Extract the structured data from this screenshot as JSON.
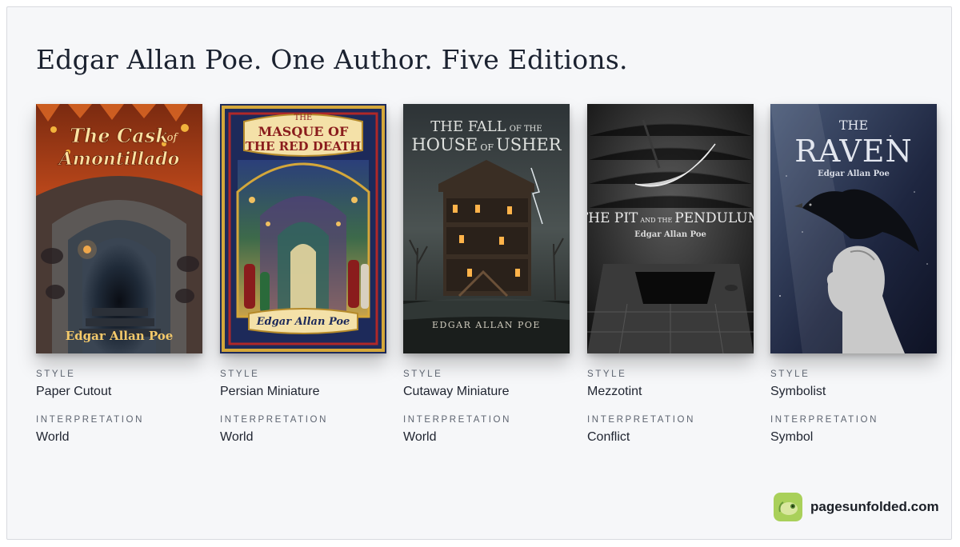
{
  "page": {
    "title": "Edgar Allan Poe. One Author. Five Editions."
  },
  "labels": {
    "style": "STYLE",
    "interpretation": "INTERPRETATION"
  },
  "books": [
    {
      "cover_title_1": "The Cask",
      "cover_title_of": "of",
      "cover_title_2": "Amontillado",
      "cover_author": "Edgar Allan Poe",
      "style": "Paper Cutout",
      "interpretation": "World"
    },
    {
      "cover_title_top": "THE",
      "cover_title_1": "MASQUE OF",
      "cover_title_2": "THE RED DEATH",
      "cover_author": "Edgar Allan Poe",
      "style": "Persian Miniature",
      "interpretation": "World"
    },
    {
      "cover_title_1a": "THE FALL",
      "cover_title_1b": "OF THE",
      "cover_title_2a": "HOUSE",
      "cover_title_2b": "OF",
      "cover_title_2c": "USHER",
      "cover_author": "EDGAR ALLAN POE",
      "style": "Cutaway Miniature",
      "interpretation": "World"
    },
    {
      "cover_title_a": "THE PIT",
      "cover_title_b": "AND THE",
      "cover_title_c": "PENDULUM",
      "cover_author": "Edgar Allan Poe",
      "style": "Mezzotint",
      "interpretation": "Conflict"
    },
    {
      "cover_title_1": "THE",
      "cover_title_2": "RAVEN",
      "cover_author": "Edgar Allan Poe",
      "style": "Symbolist",
      "interpretation": "Symbol"
    }
  ],
  "brand": {
    "text": "pagesunfolded.com",
    "logo_icon": "chameleon-logo-icon"
  },
  "colors": {
    "background": "#f6f7f9",
    "title": "#1b2230",
    "label": "#5d6470"
  }
}
